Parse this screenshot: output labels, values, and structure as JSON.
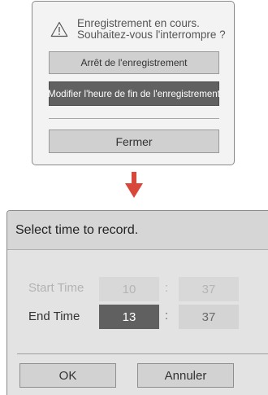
{
  "recording_dialog": {
    "message_line1": "Enregistrement en cours.",
    "message_line2": "Souhaitez-vous l'interrompre ?",
    "stop_label": "Arrêt de l'enregistrement",
    "modify_label": "Modifier l'heure de fin de l'enregistrement",
    "close_label": "Fermer",
    "icon": "warning-triangle-icon"
  },
  "arrow": {
    "icon": "arrow-down-icon",
    "color": "#d9473b"
  },
  "time_dialog": {
    "title": "Select time to record.",
    "start_label": "Start Time",
    "start_hour": "10",
    "start_minute": "37",
    "end_label": "End Time",
    "end_hour": "13",
    "end_minute": "37",
    "separator": ":",
    "ok_label": "OK",
    "cancel_label": "Annuler"
  }
}
